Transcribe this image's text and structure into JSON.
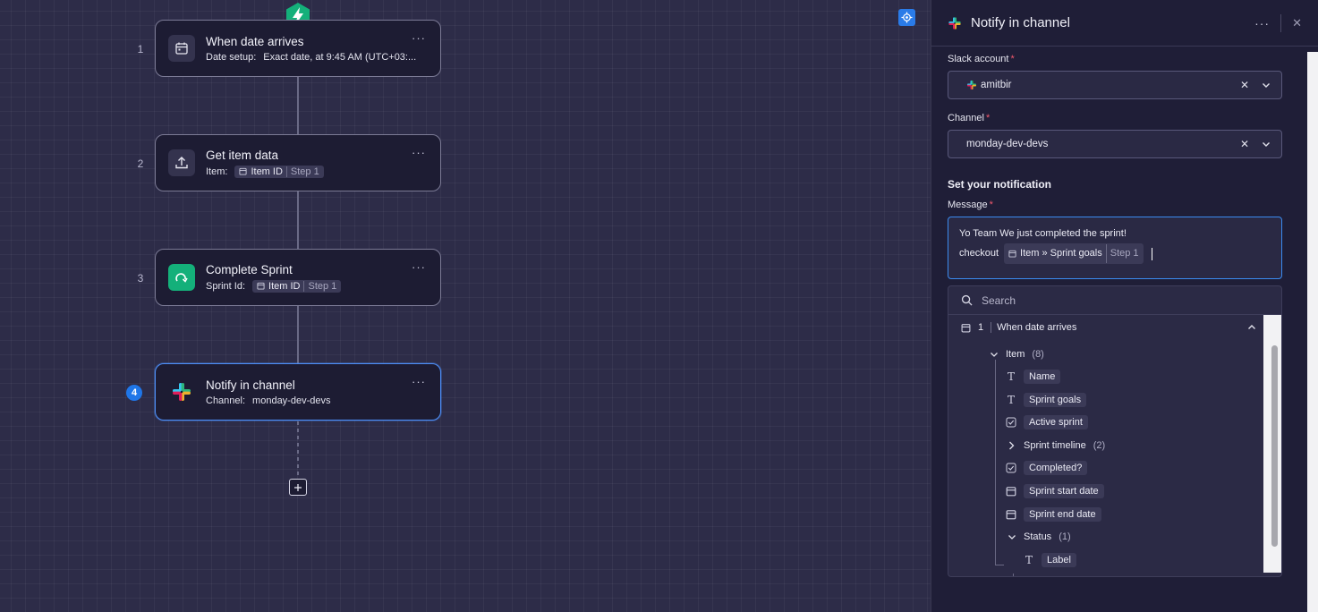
{
  "canvas": {
    "steps": [
      {
        "num": "1",
        "title": "When date arrives",
        "sub_label": "Date setup:",
        "sub_value": "Exact date, at 9:45 AM (UTC+03:...",
        "icon": "calendar-icon"
      },
      {
        "num": "2",
        "title": "Get item data",
        "sub_label": "Item:",
        "chip_label": "Item ID",
        "chip_step": "Step 1",
        "icon": "upload-icon"
      },
      {
        "num": "3",
        "title": "Complete Sprint",
        "sub_label": "Sprint Id:",
        "chip_label": "Item ID",
        "chip_step": "Step 1",
        "icon": "sprint-icon"
      },
      {
        "num": "4",
        "title": "Notify in channel",
        "sub_label": "Channel:",
        "sub_value": "monday-dev-devs",
        "icon": "slack-icon"
      }
    ],
    "more_label": "···",
    "accent_color": "#1f76e8"
  },
  "panel": {
    "title": "Notify in channel",
    "more_label": "···",
    "close_label": "✕",
    "slack_account": {
      "label": "Slack account",
      "required": "*",
      "value": "amitbir"
    },
    "channel": {
      "label": "Channel",
      "required": "*",
      "value": "monday-dev-devs"
    },
    "section_title": "Set your notification",
    "message": {
      "label": "Message",
      "required": "*",
      "line1": "Yo Team We just completed the sprint!",
      "line2_prefix": "checkout",
      "chip_label": "Item » Sprint goals",
      "chip_step": "Step 1"
    },
    "dropdown": {
      "search_placeholder": "Search",
      "group_num": "1",
      "group_label": "When date arrives",
      "item_label": "Item",
      "item_count": "(8)",
      "fields": [
        {
          "label": "Name",
          "icon": "text-icon"
        },
        {
          "label": "Sprint goals",
          "icon": "text-icon"
        },
        {
          "label": "Active sprint",
          "icon": "checkbox-icon"
        },
        {
          "label": "Sprint timeline",
          "count": "(2)",
          "icon": "chevron-right-icon"
        },
        {
          "label": "Completed?",
          "icon": "checkbox-icon"
        },
        {
          "label": "Sprint start date",
          "icon": "calendar-icon"
        },
        {
          "label": "Sprint end date",
          "icon": "calendar-icon"
        }
      ],
      "status_label": "Status",
      "status_count": "(1)",
      "status_child": "Label"
    }
  }
}
